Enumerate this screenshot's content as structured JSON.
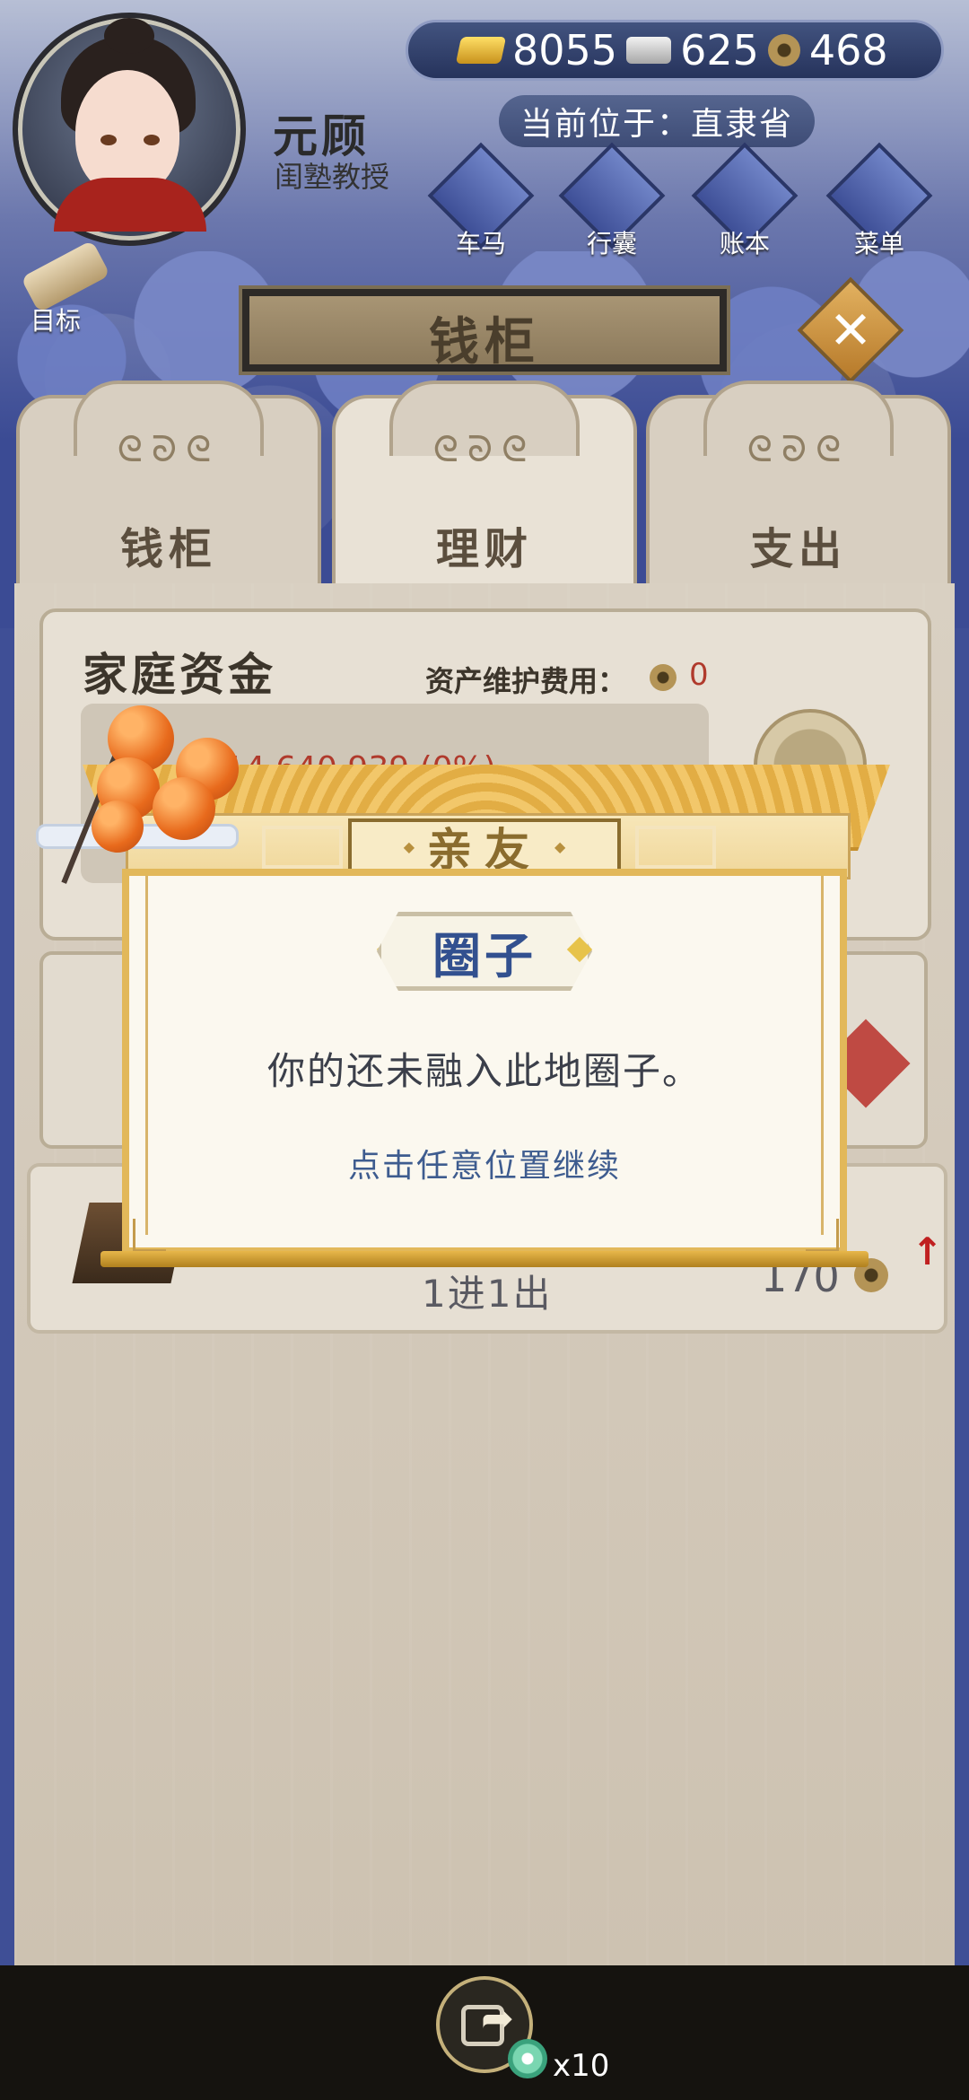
{
  "player": {
    "name": "元顾",
    "title": "闺塾教授"
  },
  "currency": {
    "gold": "8055",
    "silver": "625",
    "coin": "468"
  },
  "location": "当前位于：直隶省",
  "nav": [
    "车马",
    "行囊",
    "账本",
    "菜单"
  ],
  "target_label": "目标",
  "header_title": "钱柜",
  "tabs": [
    "钱柜",
    "理财",
    "支出"
  ],
  "active_tab": "理财",
  "fund": {
    "title": "家庭资金",
    "fee_label": "资产维护费用：",
    "fee_value": "0",
    "amounts_partial": "14 640 939 (0%)"
  },
  "row2": {
    "label": "1进1出",
    "value": "170"
  },
  "modal": {
    "header": "亲友",
    "badge": "圈子",
    "message": "你的还未融入此地圈子。",
    "tap_hint": "点击任意位置继续"
  },
  "bottom": {
    "multiplier": "x10"
  }
}
